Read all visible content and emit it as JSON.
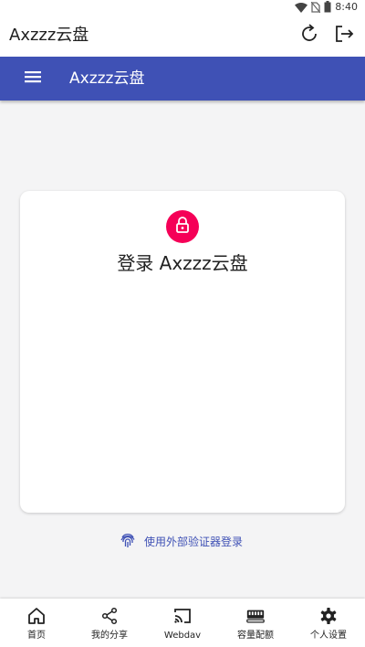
{
  "status_bar": {
    "time": "8:40"
  },
  "app_bar": {
    "title": "Axzzz云盘"
  },
  "nav_bar": {
    "title": "Axzzz云盘",
    "accent_color": "#3f51b5"
  },
  "login_card": {
    "title": "登录 Axzzz云盘",
    "badge_color": "#f50057"
  },
  "external_auth": {
    "label": "使用外部验证器登录"
  },
  "bottom_nav": {
    "tabs": [
      {
        "label": "首页",
        "icon": "home-icon"
      },
      {
        "label": "我的分享",
        "icon": "share-icon"
      },
      {
        "label": "Webdav",
        "icon": "cast-icon"
      },
      {
        "label": "容量配额",
        "icon": "storage-icon"
      },
      {
        "label": "个人设置",
        "icon": "gear-icon"
      }
    ]
  }
}
